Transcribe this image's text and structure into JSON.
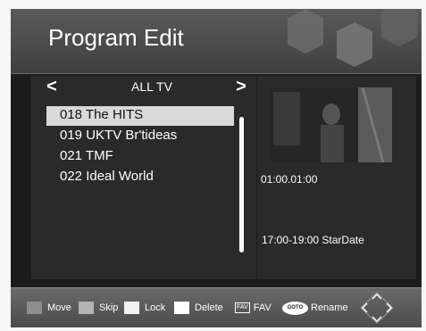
{
  "header": {
    "title": "Program Edit"
  },
  "group_nav": {
    "prev": "<",
    "label": "ALL TV",
    "next": ">"
  },
  "channels": [
    {
      "label": "018 The HITS",
      "selected": true
    },
    {
      "label": "019 UKTV Br'tideas",
      "selected": false
    },
    {
      "label": "021 TMF",
      "selected": false
    },
    {
      "label": "022 Ideal World",
      "selected": false
    }
  ],
  "info": {
    "time_code": "01:00.01:00",
    "schedule": "17:00-19:00  StarDate"
  },
  "footer": {
    "move": {
      "label": "Move",
      "color": "#8d8d8d"
    },
    "skip": {
      "label": "Skip",
      "color": "#b4b4b4"
    },
    "lock": {
      "label": "Lock",
      "color": "#f2f2f2"
    },
    "delete": {
      "label": "Delete",
      "color": "#ffffff"
    },
    "fav": {
      "key": "FAV",
      "label": "FAV"
    },
    "goto": {
      "key": "GOTO",
      "label": "Rename"
    }
  }
}
